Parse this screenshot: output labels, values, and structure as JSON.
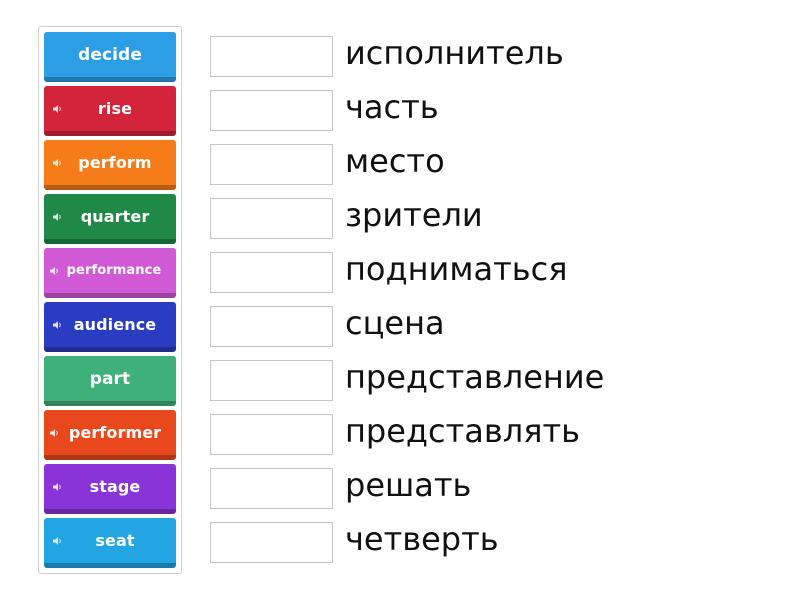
{
  "tiles": [
    {
      "label": "decide",
      "color": "#2c9ee6",
      "speaker": false
    },
    {
      "label": "rise",
      "color": "#d2243b",
      "speaker": true
    },
    {
      "label": "perform",
      "color": "#f57c19",
      "speaker": true
    },
    {
      "label": "quarter",
      "color": "#1f8a48",
      "speaker": true
    },
    {
      "label": "performance",
      "color": "#d05ad6",
      "speaker": true
    },
    {
      "label": "audience",
      "color": "#2a3cc2",
      "speaker": true
    },
    {
      "label": "part",
      "color": "#3fb079",
      "speaker": false
    },
    {
      "label": "performer",
      "color": "#e8481b",
      "speaker": true
    },
    {
      "label": "stage",
      "color": "#8a33d8",
      "speaker": true
    },
    {
      "label": "seat",
      "color": "#23a4e3",
      "speaker": true
    }
  ],
  "targets": [
    {
      "label": "исполнитель"
    },
    {
      "label": "часть"
    },
    {
      "label": "место"
    },
    {
      "label": "зрители"
    },
    {
      "label": "подниматься"
    },
    {
      "label": "сцена"
    },
    {
      "label": "представление"
    },
    {
      "label": "представлять"
    },
    {
      "label": "решать"
    },
    {
      "label": "четверть"
    }
  ]
}
